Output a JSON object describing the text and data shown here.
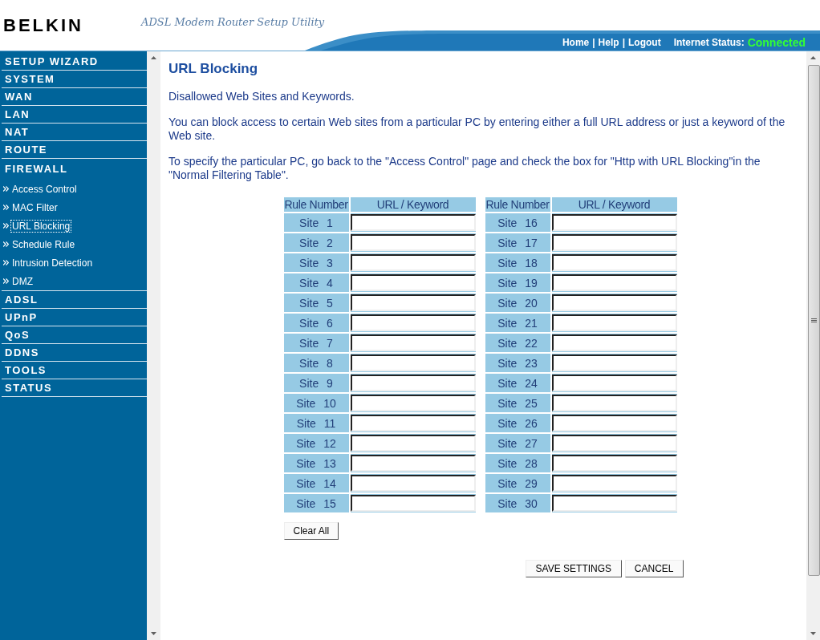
{
  "header": {
    "logo": "BELKIN",
    "subtitle": "ADSL Modem Router Setup Utility",
    "nav": [
      "Home",
      "|",
      "Help",
      "|",
      "Logout"
    ],
    "status_label": "Internet Status:",
    "status_value": "Connected"
  },
  "sidebar": {
    "items": [
      {
        "label": "SETUP WIZARD",
        "kind": "section",
        "selected": false
      },
      {
        "label": "SYSTEM",
        "kind": "section",
        "selected": false
      },
      {
        "label": "WAN",
        "kind": "section",
        "selected": false
      },
      {
        "label": "LAN",
        "kind": "section",
        "selected": false
      },
      {
        "label": "NAT",
        "kind": "section",
        "selected": false
      },
      {
        "label": "ROUTE",
        "kind": "section",
        "selected": false
      },
      {
        "label": "FIREWALL",
        "kind": "section",
        "selected": false
      },
      {
        "label": "Access Control",
        "kind": "sub",
        "selected": false
      },
      {
        "label": "MAC Filter",
        "kind": "sub",
        "selected": false
      },
      {
        "label": "URL Blocking",
        "kind": "sub",
        "selected": true
      },
      {
        "label": "Schedule Rule",
        "kind": "sub",
        "selected": false
      },
      {
        "label": "Intrusion Detection",
        "kind": "sub",
        "selected": false
      },
      {
        "label": "DMZ",
        "kind": "sub",
        "selected": false
      },
      {
        "label": "ADSL",
        "kind": "section",
        "selected": false
      },
      {
        "label": "UPnP",
        "kind": "section",
        "selected": false
      },
      {
        "label": "QoS",
        "kind": "section",
        "selected": false
      },
      {
        "label": "DDNS",
        "kind": "section",
        "selected": false
      },
      {
        "label": "TOOLS",
        "kind": "section",
        "selected": false
      },
      {
        "label": "STATUS",
        "kind": "section",
        "selected": false
      }
    ]
  },
  "content": {
    "title": "URL Blocking",
    "paragraphs": [
      "Disallowed Web Sites and Keywords.",
      "You can block access to certain Web sites from a particular PC by entering either a full URL address or just a keyword of the Web site.",
      "To specify the particular PC, go back to the \"Access Control\" page and check the box for \"Http with URL Blocking\"in the \"Normal Filtering Table\"."
    ],
    "tables": [
      {
        "columns": [
          "Rule Number",
          "URL / Keyword"
        ],
        "rows": [
          "Site 1",
          "Site 2",
          "Site 3",
          "Site 4",
          "Site 5",
          "Site 6",
          "Site 7",
          "Site 8",
          "Site 9",
          "Site 10",
          "Site 11",
          "Site 12",
          "Site 13",
          "Site 14",
          "Site 15"
        ]
      },
      {
        "columns": [
          "Rule Number",
          "URL / Keyword"
        ],
        "rows": [
          "Site 16",
          "Site 17",
          "Site 18",
          "Site 19",
          "Site 20",
          "Site 21",
          "Site 22",
          "Site 23",
          "Site 24",
          "Site 25",
          "Site 26",
          "Site 27",
          "Site 28",
          "Site 29",
          "Site 30"
        ]
      }
    ],
    "clear_button": "Clear All",
    "save_button": "SAVE SETTINGS",
    "cancel_button": "CANCEL"
  }
}
